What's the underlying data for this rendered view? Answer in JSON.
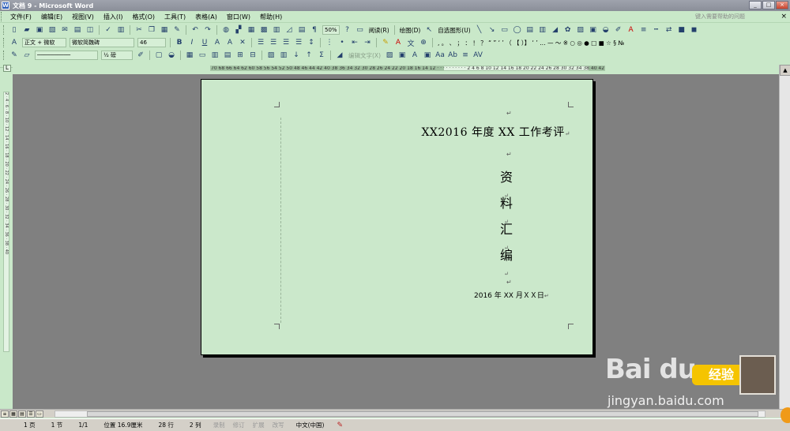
{
  "window": {
    "title": "文档 9 - Microsoft Word",
    "buttons": [
      "_",
      "□",
      "×"
    ]
  },
  "menu": {
    "items": [
      "文件(F)",
      "编辑(E)",
      "视图(V)",
      "插入(I)",
      "格式(O)",
      "工具(T)",
      "表格(A)",
      "窗口(W)",
      "帮助(H)"
    ],
    "help_placeholder": "键入需要帮助的问题",
    "close_doc": "×"
  },
  "toolbar_standard": {
    "zoom": "50%",
    "read_label": "阅读(R)",
    "draw_label": "绘图(D)",
    "autoshape_label": "自选图形(U)"
  },
  "toolbar_formatting": {
    "style": "正文 + 微软",
    "font": "微软简魏碑",
    "size": "46"
  },
  "toolbar_tables": {
    "line_weight": "½ 磅",
    "edit_text_label": "编辑文字(X)"
  },
  "ruler": {
    "scale_text": "70 68 66 64 62 60 58 56 54 52 50 48 46 44 42 40 38 36 34 32 30 28 26 24 22 20 18 16 14 12 · · · · · · · · · · 2 4 6 8 10 12 14 16 18 20 22 24 26 28 30 32 34 38 40 42",
    "vertical_text": "2 · 4 · 6 · 8 · 10 · 12 · 14 · 16 · 18 · 20 · 22 · 24 · 26 · 28 · 30 · 32 · 34 · 36 · 38 · 40"
  },
  "document": {
    "heading": "XX2016 年度 XX 工作考评",
    "vertical_chars": [
      "资",
      "料",
      "汇",
      "编"
    ],
    "date_line": "2016 年 XX 月ＸＸ日",
    "para_mark": "↵"
  },
  "statusbar": {
    "page": "1 页",
    "section": "1 节",
    "page_of": "1/1",
    "position": "位置 16.9厘米",
    "line": "28 行",
    "column": "2 列",
    "rec": "录制",
    "trk": "修订",
    "ext": "扩展",
    "ovr": "改写",
    "language": "中文(中国)"
  },
  "watermark": {
    "logo": "Bai du",
    "badge": "经验",
    "url": "jingyan.baidu.com"
  }
}
